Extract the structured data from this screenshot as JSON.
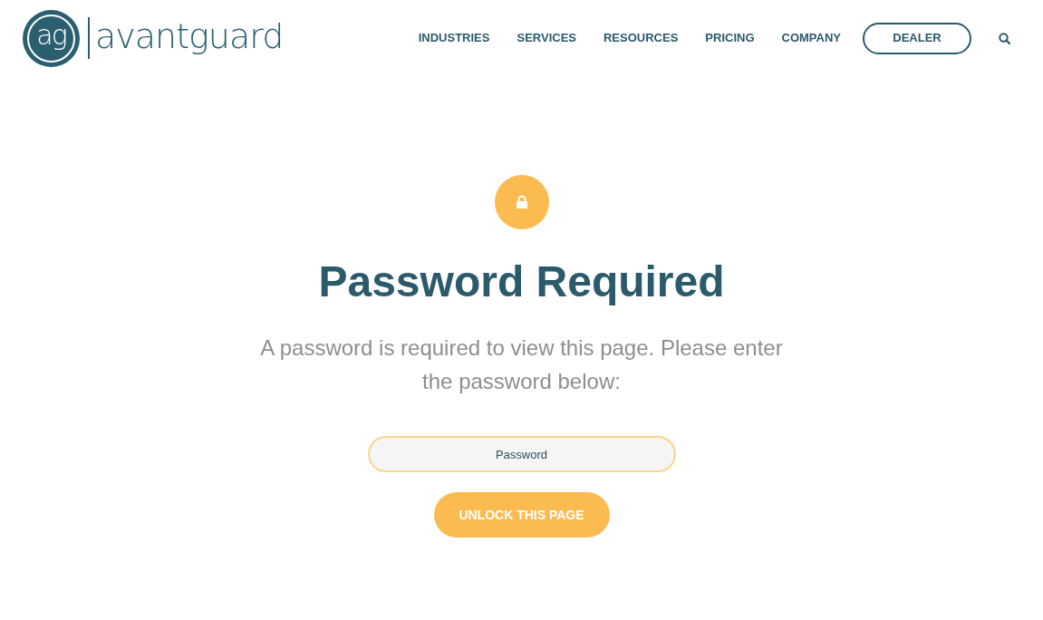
{
  "header": {
    "logo": {
      "monogram": "ag",
      "wordmark": "avantguard"
    },
    "nav": [
      {
        "label": "INDUSTRIES",
        "kind": "link"
      },
      {
        "label": "SERVICES",
        "kind": "link"
      },
      {
        "label": "RESOURCES",
        "kind": "link"
      },
      {
        "label": "PRICING",
        "kind": "link"
      },
      {
        "label": "COMPANY",
        "kind": "link"
      },
      {
        "label": "DEALER",
        "kind": "button"
      }
    ]
  },
  "main": {
    "title": "Password Required",
    "message": "A password is required to view this page. Please enter the password below:",
    "password_field": {
      "placeholder": "Password",
      "focused": true
    },
    "submit_button": "UNLOCK THIS PAGE"
  }
}
